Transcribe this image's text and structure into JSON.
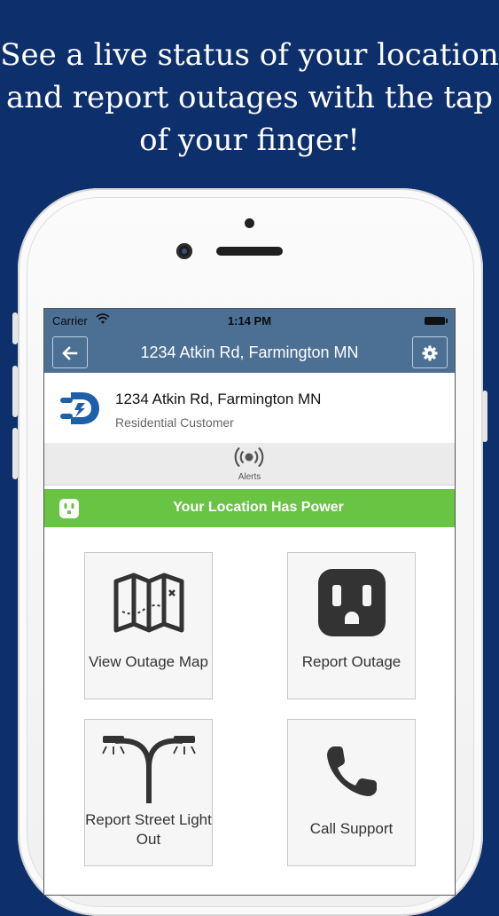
{
  "headline": "See a live status of your location and report outages with the tap of your finger!",
  "status_bar": {
    "carrier": "Carrier",
    "time": "1:14 PM"
  },
  "nav": {
    "title": "1234 Atkin Rd, Farmington MN",
    "back_icon": "back-arrow-icon",
    "settings_icon": "gear-icon"
  },
  "account": {
    "address": "1234 Atkin Rd, Farmington MN",
    "customer_type": "Residential Customer"
  },
  "alerts": {
    "label": "Alerts"
  },
  "power_status": {
    "text": "Your Location Has Power",
    "color": "#68c442"
  },
  "tiles": [
    {
      "label": "View Outage Map",
      "icon": "map-icon"
    },
    {
      "label": "Report Outage",
      "icon": "outlet-icon"
    },
    {
      "label": "Report Street Light Out",
      "icon": "street-light-icon"
    },
    {
      "label": "Call Support",
      "icon": "phone-icon"
    }
  ],
  "colors": {
    "background": "#0d2f6b",
    "navbar": "#4c6f94",
    "brand": "#1d5fa8"
  }
}
